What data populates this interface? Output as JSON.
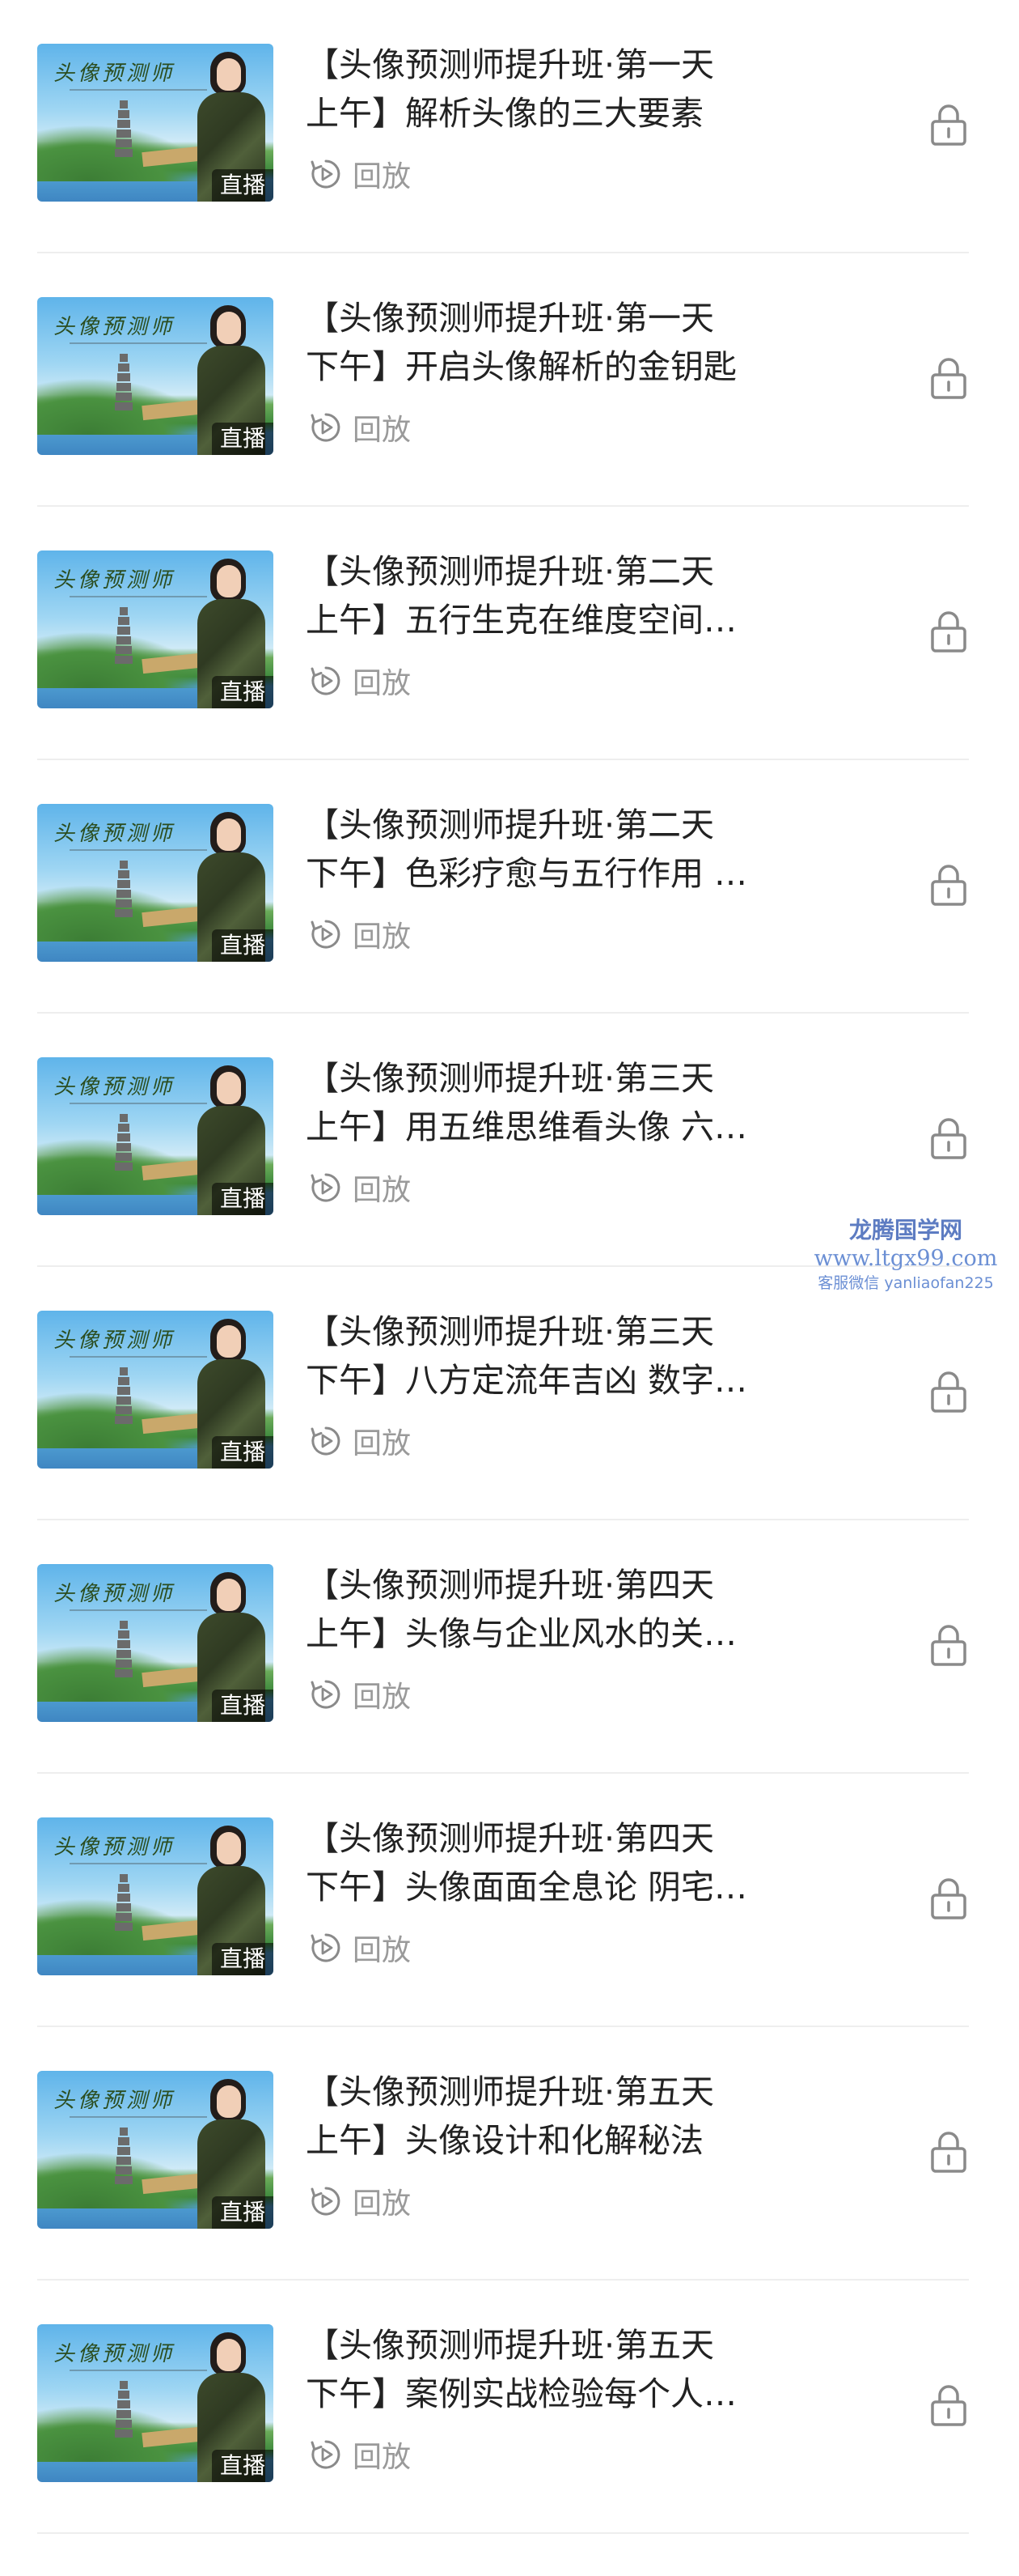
{
  "course": {
    "items": [
      {
        "title_line1": "【头像预测师提升班·第一天",
        "title_line2": "上午】解析头像的三大要素"
      },
      {
        "title_line1": "【头像预测师提升班·第一天",
        "title_line2": "下午】开启头像解析的金钥匙"
      },
      {
        "title_line1": "【头像预测师提升班·第二天",
        "title_line2": "上午】五行生克在维度空间…"
      },
      {
        "title_line1": "【头像预测师提升班·第二天",
        "title_line2": "下午】色彩疗愈与五行作用 …"
      },
      {
        "title_line1": "【头像预测师提升班·第三天",
        "title_line2": "上午】用五维思维看头像 六…"
      },
      {
        "title_line1": "【头像预测师提升班·第三天",
        "title_line2": "下午】八方定流年吉凶 数字…"
      },
      {
        "title_line1": "【头像预测师提升班·第四天",
        "title_line2": "上午】头像与企业风水的关…"
      },
      {
        "title_line1": "【头像预测师提升班·第四天",
        "title_line2": "下午】头像面面全息论 阴宅…"
      },
      {
        "title_line1": "【头像预测师提升班·第五天",
        "title_line2": "上午】头像设计和化解秘法"
      },
      {
        "title_line1": "【头像预测师提升班·第五天",
        "title_line2": "下午】案例实战检验每个人…"
      }
    ],
    "badge_label": "直播",
    "replay_label": "回放",
    "thumbnail_scroll_text": "头像预测师",
    "icons": {
      "replay": "replay-icon",
      "lock": "lock-icon"
    },
    "colors": {
      "title": "#222222",
      "replay": "#9a9a9a",
      "icon": "#8a8a8a",
      "divider": "#eeeeee"
    }
  },
  "watermark": {
    "brand": "龙腾国学网",
    "url": "www.ltgx99.com",
    "contact": "客服微信 yanliaofan225"
  }
}
